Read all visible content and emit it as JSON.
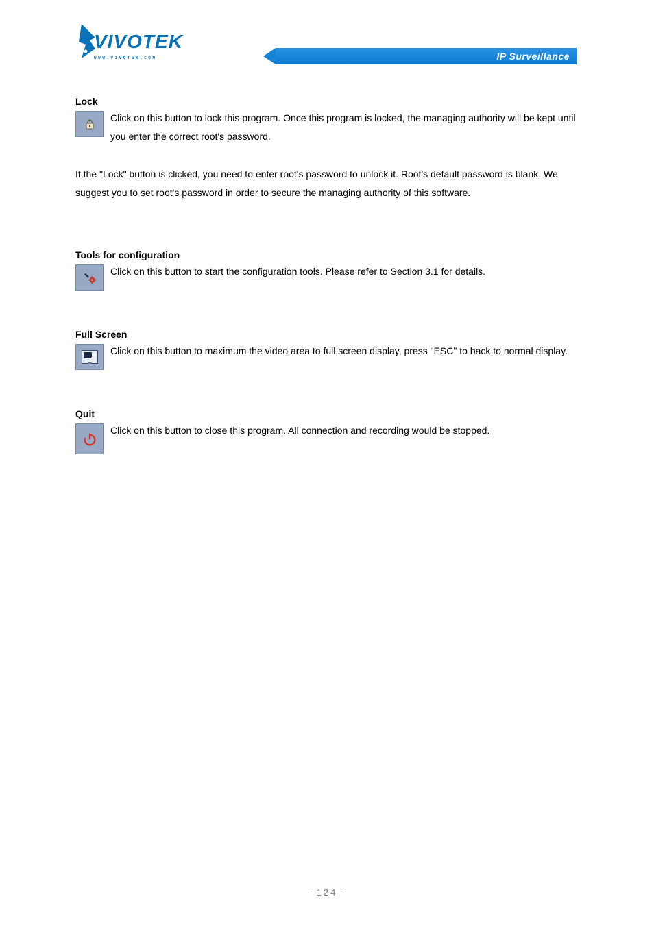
{
  "header": {
    "logo_text": "VIVOTEK",
    "logo_sub": "WWW.VIVOTEK.COM",
    "tagline": "IP Surveillance"
  },
  "sections": {
    "lock": {
      "title": "Lock",
      "desc": "Click on this button to lock this program. Once this program is locked, the managing authority will be kept until you enter the correct root's password."
    },
    "note1": " If the \"Lock\" button is clicked, you need to enter root's password to unlock it. Root's default password is blank. We suggest you to set root's password in order to secure the managing authority of this software.",
    "config": {
      "title": "Tools for configuration",
      "desc": "Click on this button to start the configuration tools. Please refer to Section 3.1 for details."
    },
    "fullscreen": {
      "title": "Full Screen",
      "desc": "Click on this button to maximum the video area to full screen display, press \"ESC\" to back to normal display."
    },
    "quit": {
      "title": "Quit",
      "desc": "Click on this button to close this program. All connection and recording would be stopped."
    }
  },
  "footer": {
    "page": "- 124 -"
  }
}
